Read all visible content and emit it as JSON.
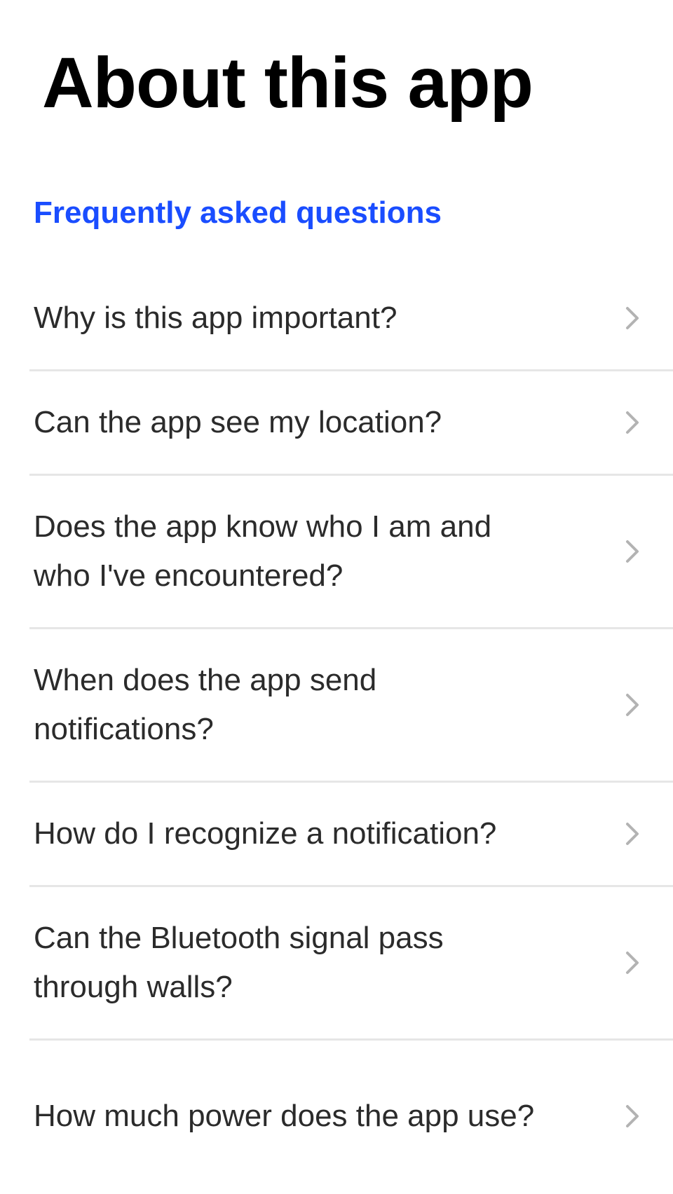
{
  "page": {
    "title": "About this app"
  },
  "faq": {
    "heading": "Frequently asked questions",
    "accent_color": "#1a4dff",
    "chevron_icon": "chevron-right-icon",
    "items": [
      {
        "label": "Why is this app important?"
      },
      {
        "label": "Can the app see my location?"
      },
      {
        "label": "Does the app know who I am and who I've encountered?"
      },
      {
        "label": "When does the app send notifications?"
      },
      {
        "label": "How do I recognize a notification?"
      },
      {
        "label": "Can the Bluetooth signal pass through walls?"
      },
      {
        "label": "How much power does the app use?"
      }
    ]
  }
}
